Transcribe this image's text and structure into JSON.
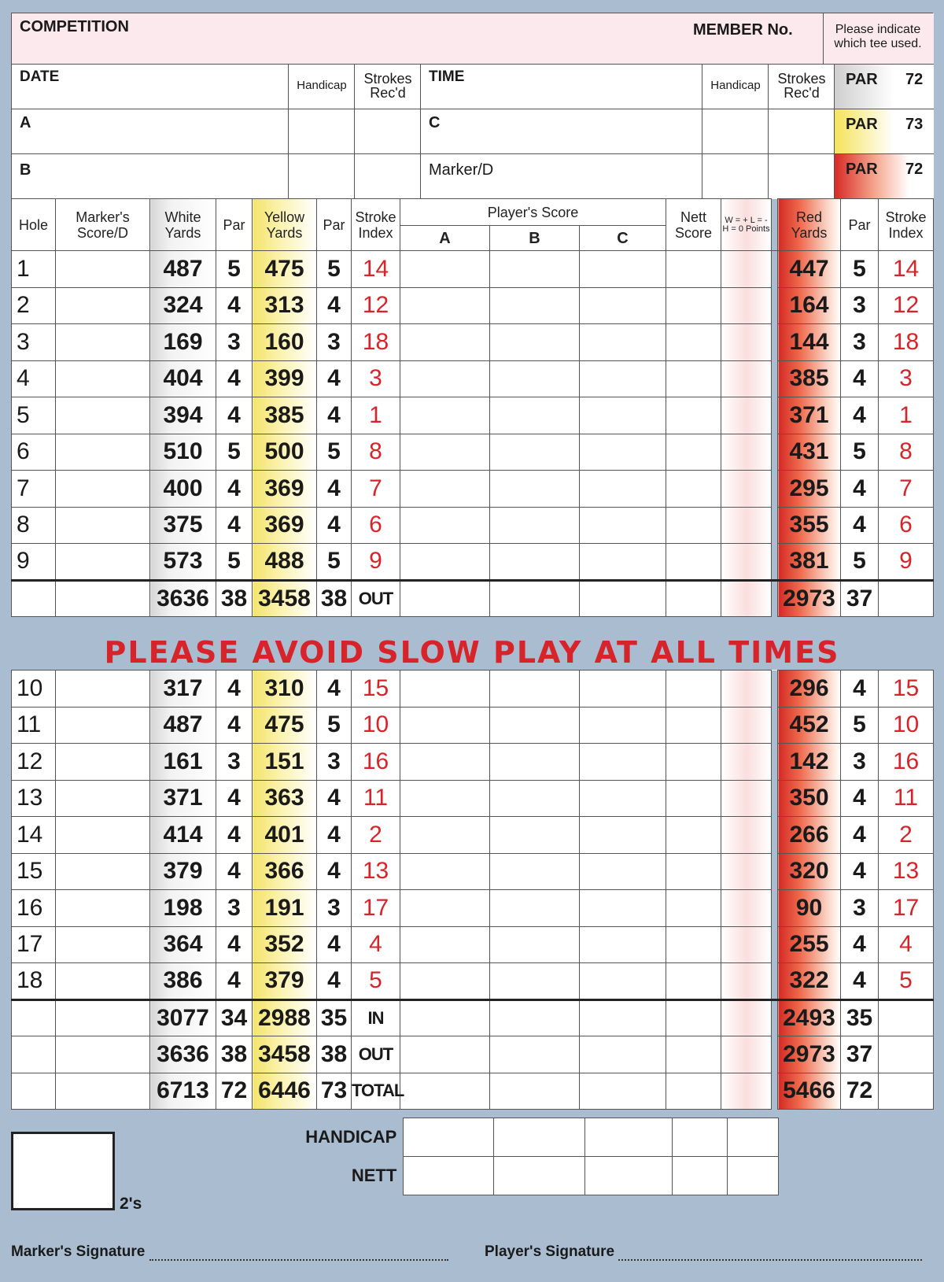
{
  "header": {
    "competition": "COMPETITION",
    "member_no": "MEMBER No.",
    "tee_note": "Please indicate which tee used.",
    "date": "DATE",
    "handicap": "Handicap",
    "strokes_recd": "Strokes Rec'd",
    "time": "TIME",
    "player_a": "A",
    "player_b": "B",
    "player_c": "C",
    "marker_d": "Marker/D",
    "par_label": "PAR",
    "par_white": "72",
    "par_yellow": "73",
    "par_red": "72"
  },
  "columns": {
    "hole": "Hole",
    "marker_score": "Marker's Score/D",
    "white_yards": "White Yards",
    "par": "Par",
    "yellow_yards": "Yellow Yards",
    "stroke_index": "Stroke Index",
    "players_score": "Player's Score",
    "a": "A",
    "b": "B",
    "c": "C",
    "nett_score": "Nett Score",
    "wlh": "W = + L = - H = 0 Points",
    "red_yards": "Red Yards"
  },
  "front": [
    {
      "hole": "1",
      "white": "487",
      "wpar": "5",
      "yellow": "475",
      "ypar": "5",
      "si": "14",
      "red": "447",
      "rpar": "5",
      "rsi": "14"
    },
    {
      "hole": "2",
      "white": "324",
      "wpar": "4",
      "yellow": "313",
      "ypar": "4",
      "si": "12",
      "red": "164",
      "rpar": "3",
      "rsi": "12"
    },
    {
      "hole": "3",
      "white": "169",
      "wpar": "3",
      "yellow": "160",
      "ypar": "3",
      "si": "18",
      "red": "144",
      "rpar": "3",
      "rsi": "18"
    },
    {
      "hole": "4",
      "white": "404",
      "wpar": "4",
      "yellow": "399",
      "ypar": "4",
      "si": "3",
      "red": "385",
      "rpar": "4",
      "rsi": "3"
    },
    {
      "hole": "5",
      "white": "394",
      "wpar": "4",
      "yellow": "385",
      "ypar": "4",
      "si": "1",
      "red": "371",
      "rpar": "4",
      "rsi": "1"
    },
    {
      "hole": "6",
      "white": "510",
      "wpar": "5",
      "yellow": "500",
      "ypar": "5",
      "si": "8",
      "red": "431",
      "rpar": "5",
      "rsi": "8"
    },
    {
      "hole": "7",
      "white": "400",
      "wpar": "4",
      "yellow": "369",
      "ypar": "4",
      "si": "7",
      "red": "295",
      "rpar": "4",
      "rsi": "7"
    },
    {
      "hole": "8",
      "white": "375",
      "wpar": "4",
      "yellow": "369",
      "ypar": "4",
      "si": "6",
      "red": "355",
      "rpar": "4",
      "rsi": "6"
    },
    {
      "hole": "9",
      "white": "573",
      "wpar": "5",
      "yellow": "488",
      "ypar": "5",
      "si": "9",
      "red": "381",
      "rpar": "5",
      "rsi": "9"
    }
  ],
  "out_total": {
    "white": "3636",
    "wpar": "38",
    "yellow": "3458",
    "ypar": "38",
    "label": "OUT",
    "red": "2973",
    "rpar": "37"
  },
  "banner": "PLEASE AVOID SLOW PLAY AT ALL TIMES",
  "back": [
    {
      "hole": "10",
      "white": "317",
      "wpar": "4",
      "yellow": "310",
      "ypar": "4",
      "si": "15",
      "red": "296",
      "rpar": "4",
      "rsi": "15"
    },
    {
      "hole": "11",
      "white": "487",
      "wpar": "4",
      "yellow": "475",
      "ypar": "5",
      "si": "10",
      "red": "452",
      "rpar": "5",
      "rsi": "10"
    },
    {
      "hole": "12",
      "white": "161",
      "wpar": "3",
      "yellow": "151",
      "ypar": "3",
      "si": "16",
      "red": "142",
      "rpar": "3",
      "rsi": "16"
    },
    {
      "hole": "13",
      "white": "371",
      "wpar": "4",
      "yellow": "363",
      "ypar": "4",
      "si": "11",
      "red": "350",
      "rpar": "4",
      "rsi": "11"
    },
    {
      "hole": "14",
      "white": "414",
      "wpar": "4",
      "yellow": "401",
      "ypar": "4",
      "si": "2",
      "red": "266",
      "rpar": "4",
      "rsi": "2"
    },
    {
      "hole": "15",
      "white": "379",
      "wpar": "4",
      "yellow": "366",
      "ypar": "4",
      "si": "13",
      "red": "320",
      "rpar": "4",
      "rsi": "13"
    },
    {
      "hole": "16",
      "white": "198",
      "wpar": "3",
      "yellow": "191",
      "ypar": "3",
      "si": "17",
      "red": "90",
      "rpar": "3",
      "rsi": "17"
    },
    {
      "hole": "17",
      "white": "364",
      "wpar": "4",
      "yellow": "352",
      "ypar": "4",
      "si": "4",
      "red": "255",
      "rpar": "4",
      "rsi": "4"
    },
    {
      "hole": "18",
      "white": "386",
      "wpar": "4",
      "yellow": "379",
      "ypar": "4",
      "si": "5",
      "red": "322",
      "rpar": "4",
      "rsi": "5"
    }
  ],
  "totals": [
    {
      "white": "3077",
      "wpar": "34",
      "yellow": "2988",
      "ypar": "35",
      "label": "IN",
      "red": "2493",
      "rpar": "35"
    },
    {
      "white": "3636",
      "wpar": "38",
      "yellow": "3458",
      "ypar": "38",
      "label": "OUT",
      "red": "2973",
      "rpar": "37"
    },
    {
      "white": "6713",
      "wpar": "72",
      "yellow": "6446",
      "ypar": "73",
      "label": "TOTAL",
      "red": "5466",
      "rpar": "72"
    }
  ],
  "footer": {
    "handicap": "HANDICAP",
    "nett": "NETT",
    "twos": "2's",
    "marker_sig": "Marker's Signature",
    "player_sig": "Player's Signature"
  }
}
